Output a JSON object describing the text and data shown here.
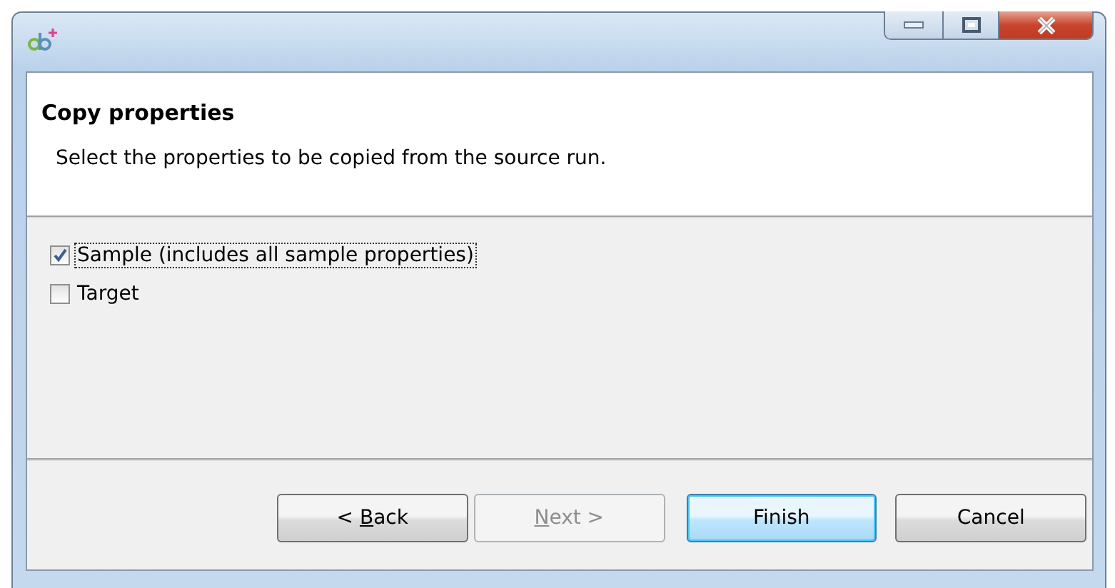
{
  "header": {
    "title": "Copy properties",
    "description": "Select the properties to be copied from the source run."
  },
  "options": [
    {
      "label": "Sample (includes all sample properties)",
      "checked": true,
      "focused": true
    },
    {
      "label": "Target",
      "checked": false,
      "focused": false
    }
  ],
  "buttons": [
    {
      "parts": [
        {
          "text": "< ",
          "underlined": false
        },
        {
          "text": "B",
          "underlined": true
        },
        {
          "text": "ack",
          "underlined": false
        }
      ],
      "disabled": false,
      "default": false
    },
    {
      "parts": [
        {
          "text": "N",
          "underlined": true
        },
        {
          "text": "ext >",
          "underlined": false
        }
      ],
      "disabled": true,
      "default": false
    },
    {
      "parts": [
        {
          "text": "Finish",
          "underlined": false
        }
      ],
      "disabled": false,
      "default": true
    },
    {
      "parts": [
        {
          "text": "Cancel",
          "underlined": false
        }
      ],
      "disabled": false,
      "default": false
    }
  ]
}
